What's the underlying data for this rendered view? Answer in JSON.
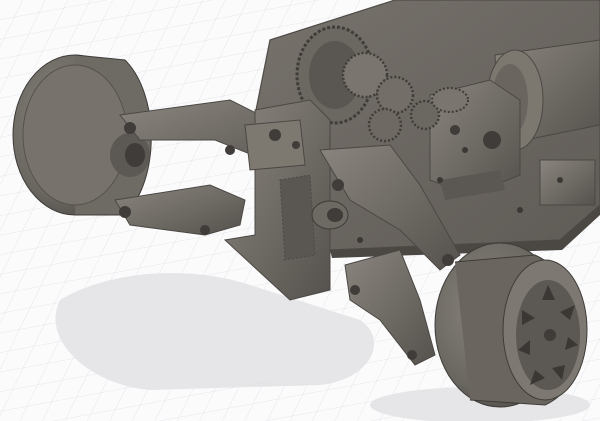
{
  "viewport": {
    "background": "#fbfbfc",
    "grid_color": "#d9dde3",
    "model_color": "#6f6b66",
    "shadow_color": "#e6e6e8"
  },
  "model": {
    "parts": [
      "chassis-plate",
      "left-front-wheel",
      "right-front-wheel",
      "upper-wishbone-left",
      "upper-wishbone-right",
      "lower-wishbone-left",
      "lower-wishbone-right",
      "suspension-tower",
      "differential-gears",
      "motor-mount",
      "bearing-block"
    ]
  }
}
